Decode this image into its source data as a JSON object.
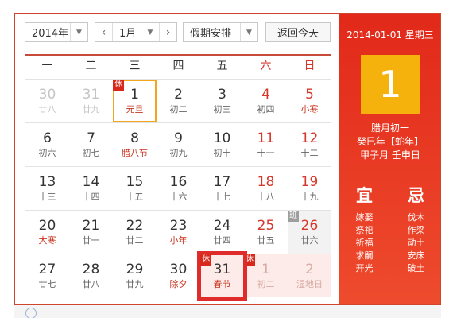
{
  "toolbar": {
    "year": "2014年",
    "month": "1月",
    "holiday_select": "假期安排",
    "today_button": "返回今天",
    "prev_icon": "chevron-left-icon",
    "next_icon": "chevron-right-icon",
    "dropdown_icon": "caret-down-icon"
  },
  "weekdays": [
    "一",
    "二",
    "三",
    "四",
    "五",
    "六",
    "日"
  ],
  "weeks": [
    [
      {
        "day": "30",
        "sub": "廿八",
        "other": true
      },
      {
        "day": "31",
        "sub": "廿九",
        "other": true
      },
      {
        "day": "1",
        "sub": "元旦",
        "festival": true,
        "badge": "休",
        "selected": true
      },
      {
        "day": "2",
        "sub": "初二"
      },
      {
        "day": "3",
        "sub": "初三"
      },
      {
        "day": "4",
        "sub": "初四",
        "weekend": true
      },
      {
        "day": "5",
        "sub": "小寒",
        "weekend": true,
        "festival": true
      }
    ],
    [
      {
        "day": "6",
        "sub": "初六"
      },
      {
        "day": "7",
        "sub": "初七"
      },
      {
        "day": "8",
        "sub": "腊八节",
        "festival": true
      },
      {
        "day": "9",
        "sub": "初九"
      },
      {
        "day": "10",
        "sub": "初十"
      },
      {
        "day": "11",
        "sub": "十一",
        "weekend": true
      },
      {
        "day": "12",
        "sub": "十二",
        "weekend": true
      }
    ],
    [
      {
        "day": "13",
        "sub": "十三"
      },
      {
        "day": "14",
        "sub": "十四"
      },
      {
        "day": "15",
        "sub": "十五"
      },
      {
        "day": "16",
        "sub": "十六"
      },
      {
        "day": "17",
        "sub": "十七"
      },
      {
        "day": "18",
        "sub": "十八",
        "weekend": true
      },
      {
        "day": "19",
        "sub": "十九",
        "weekend": true
      }
    ],
    [
      {
        "day": "20",
        "sub": "大寒",
        "festival": true
      },
      {
        "day": "21",
        "sub": "廿一"
      },
      {
        "day": "22",
        "sub": "廿二"
      },
      {
        "day": "23",
        "sub": "小年",
        "festival": true
      },
      {
        "day": "24",
        "sub": "廿四"
      },
      {
        "day": "25",
        "sub": "廿五",
        "weekend": true
      },
      {
        "day": "26",
        "sub": "廿六",
        "weekend": true,
        "badge": "班",
        "workday": true
      }
    ],
    [
      {
        "day": "27",
        "sub": "廿七"
      },
      {
        "day": "28",
        "sub": "廿八"
      },
      {
        "day": "29",
        "sub": "廿九"
      },
      {
        "day": "30",
        "sub": "除夕",
        "festival": true
      },
      {
        "day": "31",
        "sub": "春节",
        "festival": true,
        "badge": "休",
        "rest": true,
        "highlight": true
      },
      {
        "day": "1",
        "sub": "初二",
        "other": true,
        "badge": "休",
        "rest": true
      },
      {
        "day": "2",
        "sub": "湿地日",
        "other": true,
        "rest": true
      }
    ]
  ],
  "side": {
    "date": "2014-01-01 星期三",
    "big_day": "1",
    "lunar_day": "腊月初一",
    "year_ganzhi": "癸巳年【蛇年】",
    "month_ganzhi": "甲子月 壬申日",
    "yi_title": "宜",
    "ji_title": "忌",
    "yi": [
      "嫁娶",
      "祭祀",
      "祈福",
      "求嗣",
      "开光"
    ],
    "ji": [
      "伐木",
      "作梁",
      "动土",
      "安床",
      "破土"
    ]
  },
  "bottom": {
    "icon": "info-icon"
  },
  "colors": {
    "accent_red": "#e2291a",
    "weekend_red": "#d5382b",
    "today_gold": "#f5b20d",
    "rest_bg": "#fcebe9",
    "highlight_red": "#e02b2b"
  }
}
